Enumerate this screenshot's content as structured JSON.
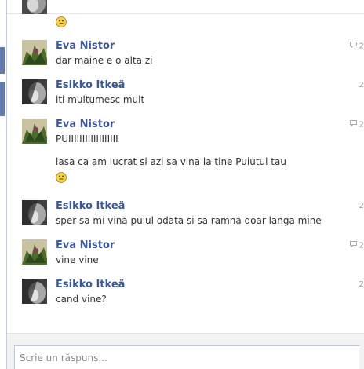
{
  "conversation": {
    "reply_placeholder": "Scrie un răspuns...",
    "messages": [
      {
        "author": "Eva Nistor",
        "lines": [
          "dar maine e o alta zi"
        ],
        "time": "2"
      },
      {
        "author": "Esikko Itkeä",
        "lines": [
          "iti multumesc mult"
        ],
        "time": "2"
      },
      {
        "author": "Eva Nistor",
        "lines": [
          "PUIIIIIIIIIIIIIIIIII",
          "lasa ca am lucrat si azi sa vina la tine Puiutul tau"
        ],
        "time": "2"
      },
      {
        "author": "Esikko Itkeä",
        "lines": [
          "sper sa mi vina puiul odata si sa ramna doar langa mine"
        ],
        "time": "2"
      },
      {
        "author": "Eva Nistor",
        "lines": [
          "vine vine"
        ],
        "time": "2"
      },
      {
        "author": "Esikko Itkeä",
        "lines": [
          "cand vine?"
        ],
        "time": "2"
      }
    ]
  },
  "colors": {
    "author": "#3b5998",
    "accent_tab": "#627aad",
    "composer_bg": "#f2f2f2"
  },
  "icons": {
    "emoticon": "smiley-icon",
    "comment": "comment-bubble-icon"
  }
}
